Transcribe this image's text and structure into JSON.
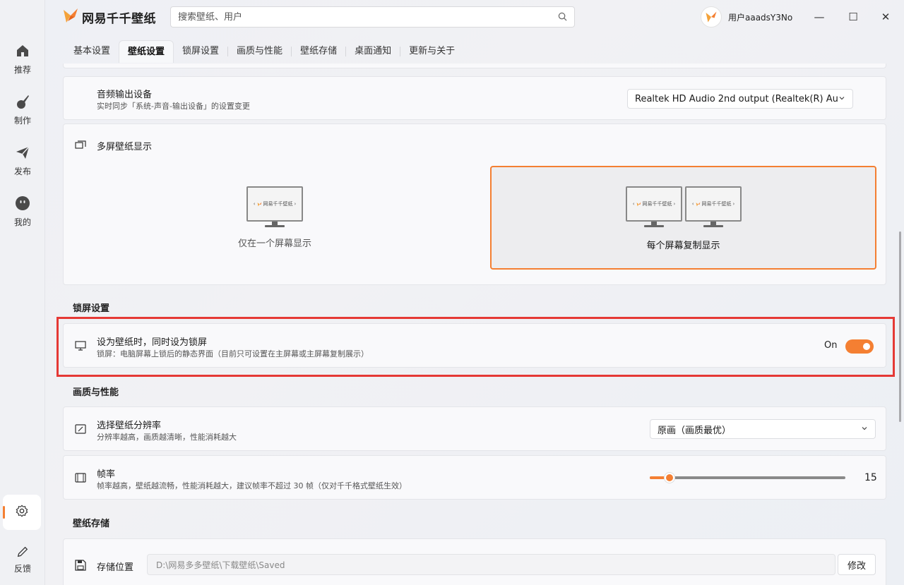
{
  "app": {
    "title": "网易千千壁纸"
  },
  "search": {
    "placeholder": "搜索壁纸、用户"
  },
  "user": {
    "name": "用户aaadsY3No"
  },
  "window_controls": {
    "minimize": "—",
    "maximize": "☐",
    "close": "✕"
  },
  "sidebar": {
    "items": [
      {
        "label": "推荐",
        "icon": "home-icon"
      },
      {
        "label": "制作",
        "icon": "brush-icon"
      },
      {
        "label": "发布",
        "icon": "send-icon"
      },
      {
        "label": "我的",
        "icon": "face-icon"
      }
    ],
    "settings_icon": "gear-icon",
    "feedback_label": "反馈"
  },
  "tabs": [
    "基本设置",
    "壁纸设置",
    "锁屏设置",
    "画质与性能",
    "壁纸存储",
    "桌面通知",
    "更新与关于"
  ],
  "active_tab": "壁纸设置",
  "audio": {
    "title": "音频输出设备",
    "subtitle": "实时同步「系统-声音-输出设备」的设置变更",
    "value": "Realtek HD Audio 2nd output (Realtek(R) Au..."
  },
  "multi_screen": {
    "title": "多屏壁纸显示",
    "option_single": "仅在一个屏幕显示",
    "option_mirror": "每个屏幕复制显示",
    "monitor_brand": "网易千千壁纸",
    "selected": "每个屏幕复制显示"
  },
  "lock_section": {
    "heading": "锁屏设置",
    "title": "设为壁纸时，同时设为锁屏",
    "subtitle": "锁屏：电脑屏幕上锁后的静态界面（目前只可设置在主屏幕或主屏幕复制展示）",
    "toggle_label": "On",
    "toggle_on": true
  },
  "quality_section": {
    "heading": "画质与性能",
    "resolution_title": "选择壁纸分辨率",
    "resolution_subtitle": "分辨率越高，画质越清晰，性能消耗越大",
    "resolution_value": "原画（画质最优）",
    "fps_title": "帧率",
    "fps_subtitle": "帧率越高，壁纸越流畅，性能消耗越大，建议帧率不超过 30 帧（仅对千千格式壁纸生效）",
    "fps_value": "15",
    "fps_fraction": 0.1
  },
  "storage_section": {
    "heading": "壁纸存储",
    "title": "存储位置",
    "path": "D:\\网易多多壁纸\\下载壁纸\\Saved",
    "modify_label": "修改"
  },
  "colors": {
    "accent": "#f47f32",
    "highlight": "#e53935"
  }
}
